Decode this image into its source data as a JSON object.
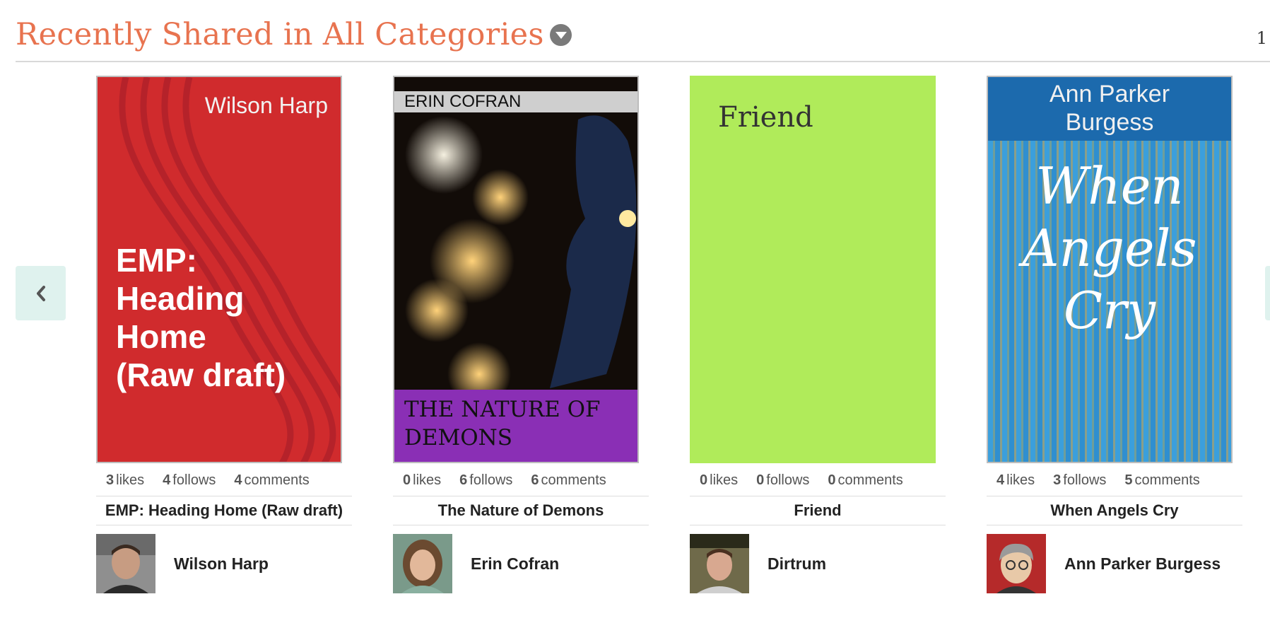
{
  "section": {
    "title": "Recently Shared in All Categories",
    "page_indicator": "1"
  },
  "books": [
    {
      "cover": {
        "author": "Wilson Harp",
        "title": "EMP: Heading Home (Raw draft)"
      },
      "likes": "3",
      "follows": "4",
      "comments": "4",
      "title": "EMP: Heading Home (Raw draft)",
      "author": "Wilson Harp"
    },
    {
      "cover": {
        "author": "ERIN COFRAN",
        "title": "THE NATURE OF DEMONS"
      },
      "likes": "0",
      "follows": "6",
      "comments": "6",
      "title": "The Nature of Demons",
      "author": "Erin Cofran"
    },
    {
      "cover": {
        "title": "Friend"
      },
      "likes": "0",
      "follows": "0",
      "comments": "0",
      "title": "Friend",
      "author": "Dirtrum"
    },
    {
      "cover": {
        "author": "Ann Parker Burgess",
        "title": "When Angels Cry"
      },
      "likes": "4",
      "follows": "3",
      "comments": "5",
      "title": "When Angels Cry",
      "author": "Ann Parker Burgess"
    }
  ],
  "labels": {
    "likes": "likes",
    "follows": "follows",
    "comments": "comments"
  },
  "icons": {
    "prev": "chevron-left-icon",
    "dropdown": "caret-down-icon"
  },
  "colors": {
    "title": "#e8734f",
    "nav_bg": "#dff2ee"
  }
}
